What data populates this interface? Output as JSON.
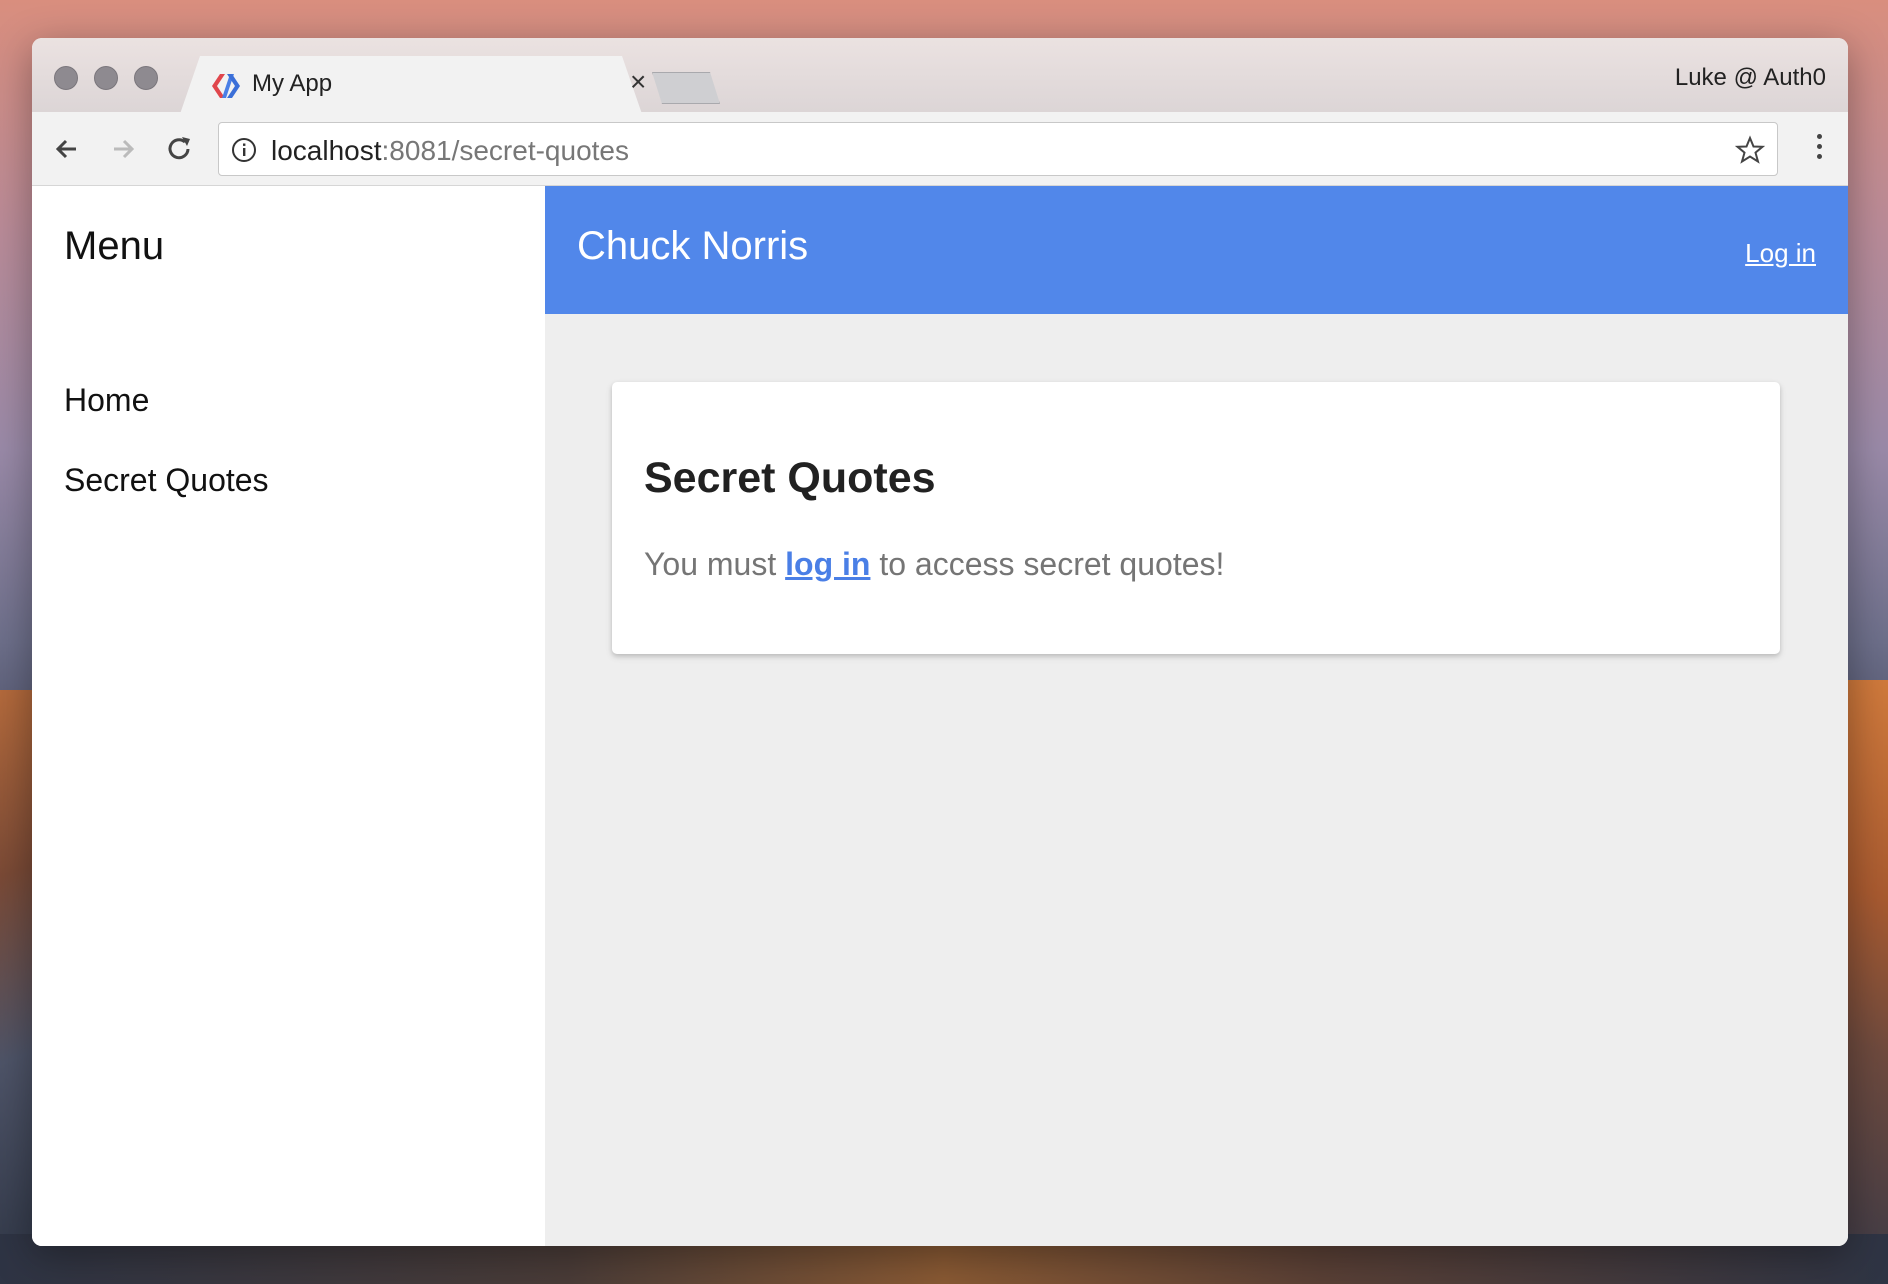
{
  "browser": {
    "tab_title": "My App",
    "tab_close": "×",
    "profile": "Luke @ Auth0",
    "url_host": "localhost",
    "url_rest": ":8081/secret-quotes"
  },
  "sidebar": {
    "title": "Menu",
    "items": [
      {
        "label": "Home"
      },
      {
        "label": "Secret Quotes"
      }
    ]
  },
  "appbar": {
    "title": "Chuck Norris",
    "login_label": "Log in",
    "color": "#5187ea"
  },
  "card": {
    "title": "Secret Quotes",
    "text_before": "You must ",
    "link_label": "log in",
    "text_after": " to access secret quotes!"
  },
  "icons": [
    "app-logo-icon",
    "close-icon",
    "back-arrow-icon",
    "forward-arrow-icon",
    "reload-icon",
    "info-icon",
    "star-icon",
    "more-vert-icon"
  ]
}
